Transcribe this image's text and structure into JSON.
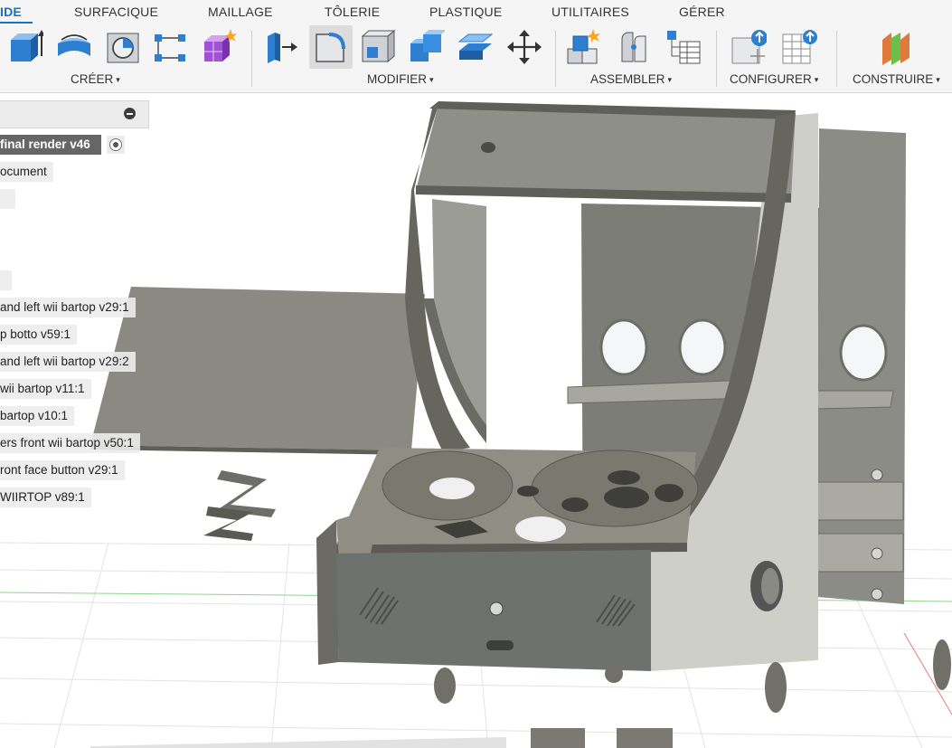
{
  "tabs": [
    {
      "label": "IDE",
      "active": true
    },
    {
      "label": "SURFACIQUE",
      "active": false
    },
    {
      "label": "MAILLAGE",
      "active": false
    },
    {
      "label": "TÔLERIE",
      "active": false
    },
    {
      "label": "PLASTIQUE",
      "active": false
    },
    {
      "label": "UTILITAIRES",
      "active": false
    },
    {
      "label": "GÉRER",
      "active": false
    }
  ],
  "groups": {
    "create": "CRÉER",
    "modify": "MODIFIER",
    "assemble": "ASSEMBLER",
    "configure": "CONFIGURER",
    "construct": "CONSTRUIRE"
  },
  "caret": "▾",
  "icons": {
    "create": [
      "extrude-icon",
      "revolve-icon",
      "hole-icon",
      "pattern-icon",
      "create-form-icon"
    ],
    "modify": [
      "press-pull-icon",
      "fillet-icon",
      "shell-icon",
      "combine-icon",
      "offset-face-icon",
      "move-icon"
    ],
    "assemble": [
      "new-component-icon",
      "joint-icon",
      "bom-table-icon"
    ],
    "configure": [
      "configure-icon",
      "configure-table-icon"
    ],
    "construct": [
      "offset-plane-icon"
    ]
  },
  "browser": {
    "document_title": "final render v46",
    "document_settings": "ocument",
    "components": [
      "and left wii bartop v29:1",
      "p botto v59:1",
      "and left wii bartop v29:2",
      "wii bartop v11:1",
      "bartop v10:1",
      "ers front wii bartop v50:1",
      "ront face button v29:1",
      "WIIRTOP v89:1"
    ]
  },
  "colors": {
    "accent": "#1a6fc9",
    "toolbar_bg": "#f5f5f5",
    "icon_blue": "#2f7fd0",
    "panel_gray": "#8a8a82",
    "panel_dark": "#6e6e68"
  }
}
